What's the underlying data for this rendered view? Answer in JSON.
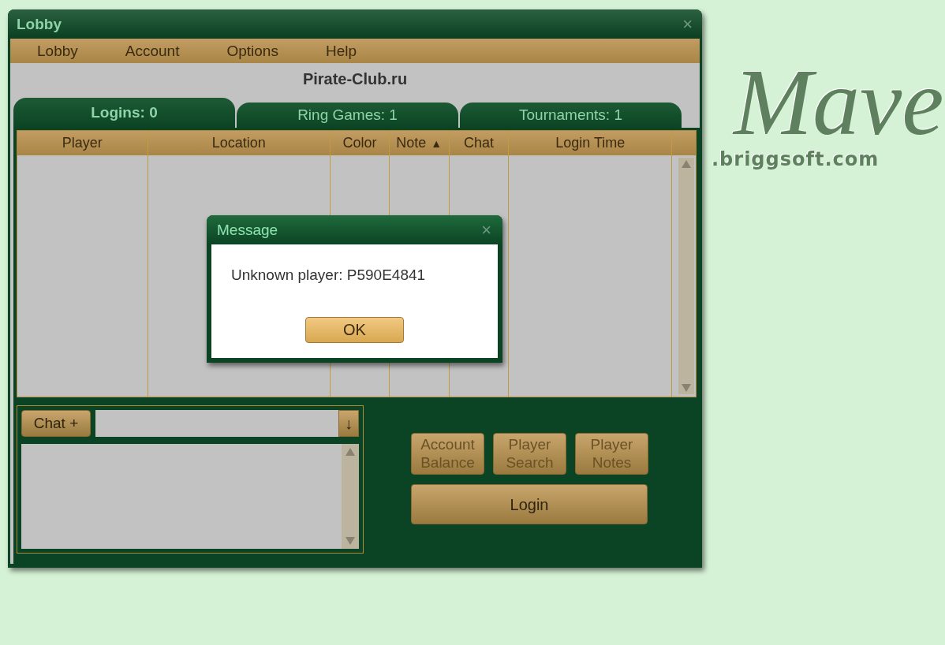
{
  "background_logo": {
    "title": "Mave",
    "url": ".briggsoft.com"
  },
  "window": {
    "title": "Lobby",
    "close": "×"
  },
  "menu": [
    "Lobby",
    "Account",
    "Options",
    "Help"
  ],
  "site_title": "Pirate-Club.ru",
  "tabs": [
    {
      "label": "Logins: 0",
      "selected": true
    },
    {
      "label": "Ring Games: 1",
      "selected": false
    },
    {
      "label": "Tournaments: 1",
      "selected": false
    }
  ],
  "table": {
    "columns": [
      {
        "label": "Player"
      },
      {
        "label": "Location"
      },
      {
        "label": "Color"
      },
      {
        "label": "Note",
        "sort_mark": "▲"
      },
      {
        "label": "Chat"
      },
      {
        "label": "Login Time"
      }
    ]
  },
  "chat": {
    "button": "Chat +",
    "scroll_button": "↓"
  },
  "buttons": [
    {
      "label": "Account Balance",
      "disabled": true
    },
    {
      "label": "Player Search",
      "disabled": true
    },
    {
      "label": "Player Notes",
      "disabled": true
    }
  ],
  "login_button": {
    "label": "Login",
    "disabled": false
  },
  "dialog": {
    "title": "Message",
    "close": "×",
    "message": "Unknown player: P590E4841",
    "ok": "OK"
  }
}
